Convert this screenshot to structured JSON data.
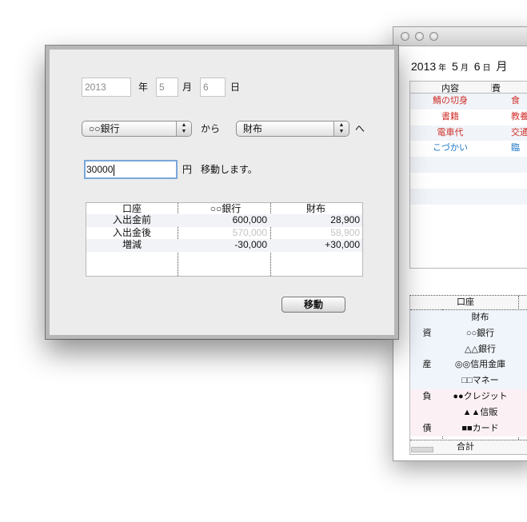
{
  "ledger_window": {
    "date": {
      "year": "2013",
      "year_unit": "年",
      "month": "5",
      "month_unit": "月",
      "day": "6",
      "day_unit": "日",
      "trailing": "月"
    },
    "list": {
      "headers": [
        "内容",
        "費"
      ],
      "rows": [
        {
          "content": "鯖の切身",
          "category": "食",
          "color": "red"
        },
        {
          "content": "書籍",
          "category": "教養",
          "color": "red"
        },
        {
          "content": "電車代",
          "category": "交通",
          "color": "red"
        },
        {
          "content": "こづかい",
          "category": "臨",
          "color": "blue"
        }
      ],
      "empty_rows": 3
    },
    "balance": {
      "header": "口座",
      "rows": [
        {
          "kind": "",
          "name": "財布",
          "group": "asset"
        },
        {
          "kind": "資",
          "name": "○○銀行",
          "group": "asset"
        },
        {
          "kind": "",
          "name": "△△銀行",
          "group": "asset"
        },
        {
          "kind": "産",
          "name": "◎◎信用金庫",
          "group": "asset"
        },
        {
          "kind": "",
          "name": "□□マネー",
          "group": "asset"
        },
        {
          "kind": "負",
          "name": "●●クレジット",
          "group": "liab"
        },
        {
          "kind": "",
          "name": "▲▲信販",
          "group": "liab"
        },
        {
          "kind": "債",
          "name": "■■カード",
          "group": "liab"
        }
      ],
      "footer": "合計"
    }
  },
  "transfer": {
    "date": {
      "year": "2013",
      "year_label": "年",
      "month": "5",
      "month_label": "月",
      "day": "6",
      "day_label": "日"
    },
    "from_account": "○○銀行",
    "from_label": "から",
    "to_account": "財布",
    "to_label": "へ",
    "amount": "30000",
    "amount_label": "円",
    "action_text": "移動します。",
    "table": {
      "headers": [
        "口座",
        "○○銀行",
        "財布"
      ],
      "rows": [
        {
          "label": "入出金前",
          "bank": "600,000",
          "wallet": "28,900"
        },
        {
          "label": "入出金後",
          "bank": "570,000",
          "wallet": "58,900"
        },
        {
          "label": "増減",
          "bank": "-30,000",
          "wallet": "+30,000"
        }
      ]
    },
    "move_button": "移動"
  }
}
